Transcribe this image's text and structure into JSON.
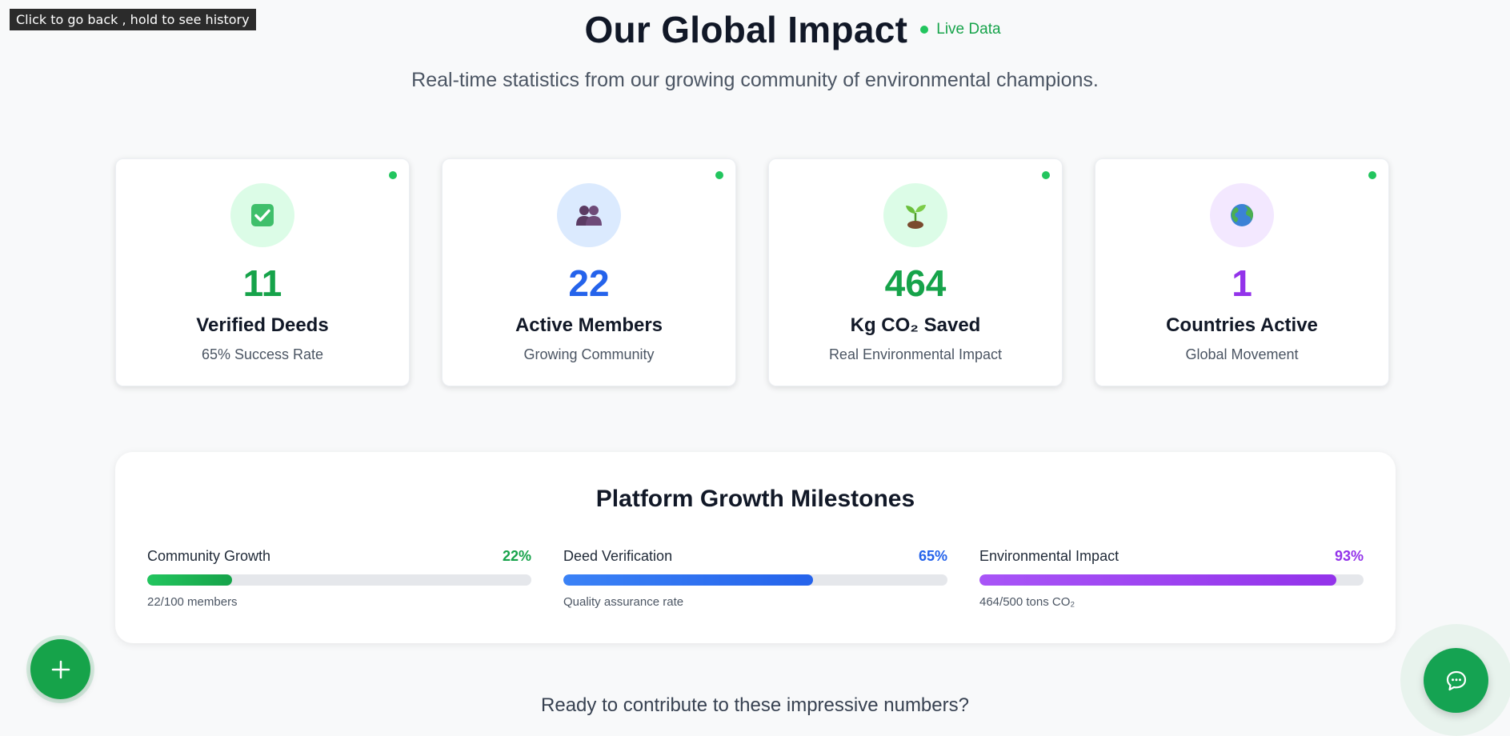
{
  "tooltip": "Click to go back , hold to see history",
  "header": {
    "title": "Our Global Impact",
    "live_label": "Live Data",
    "subtitle": "Real-time statistics from our growing community of environmental champions."
  },
  "stats": [
    {
      "value": "11",
      "label": "Verified Deeds",
      "sub": "65% Success Rate",
      "icon": "check-box-icon",
      "emoji": "✅",
      "color": "#16a34a",
      "bg": "#dcfce7"
    },
    {
      "value": "22",
      "label": "Active Members",
      "sub": "Growing Community",
      "icon": "people-icon",
      "emoji": "👥",
      "color": "#2563eb",
      "bg": "#dbeafe"
    },
    {
      "value": "464",
      "label": "Kg CO₂ Saved",
      "sub": "Real Environmental Impact",
      "icon": "seedling-icon",
      "emoji": "🌱",
      "color": "#16a34a",
      "bg": "#dcfce7"
    },
    {
      "value": "1",
      "label": "Countries Active",
      "sub": "Global Movement",
      "icon": "globe-icon",
      "emoji": "🌍",
      "color": "#9333ea",
      "bg": "#f3e8ff"
    }
  ],
  "milestones": {
    "title": "Platform Growth Milestones",
    "items": [
      {
        "label": "Community Growth",
        "percent_label": "22%",
        "percent": 22,
        "note": "22/100 members",
        "color": "#16a34a",
        "gradient": [
          "#22c55e",
          "#16a34a"
        ]
      },
      {
        "label": "Deed Verification",
        "percent_label": "65%",
        "percent": 65,
        "note": "Quality assurance rate",
        "color": "#2563eb",
        "gradient": [
          "#3b82f6",
          "#2563eb"
        ]
      },
      {
        "label": "Environmental Impact",
        "percent_label": "93%",
        "percent": 93,
        "note": "464/500 tons CO₂",
        "color": "#9333ea",
        "gradient": [
          "#a855f7",
          "#9333ea"
        ]
      }
    ]
  },
  "cta": "Ready to contribute to these impressive numbers?",
  "fab": {
    "add_icon": "plus-icon",
    "chat_icon": "chat-bubble-icon"
  }
}
